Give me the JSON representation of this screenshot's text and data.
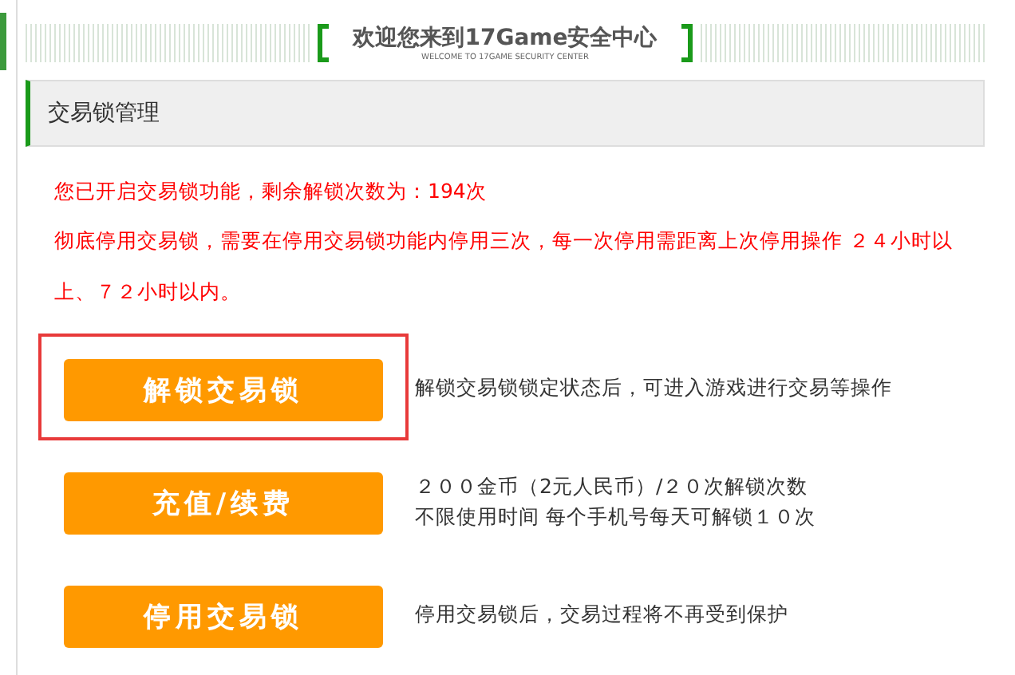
{
  "header": {
    "title": "欢迎您来到17Game安全中心",
    "subtitle": "WELCOME TO 17GAME SECURITY CENTER"
  },
  "panel": {
    "title": "交易锁管理"
  },
  "notices": [
    "您已开启交易锁功能，剩余解锁次数为：194次",
    "彻底停用交易锁，需要在停用交易锁功能内停用三次，每一次停用需距离上次停用操作 ２４小时以上、７２小时以内。"
  ],
  "actions": [
    {
      "label": "解锁交易锁",
      "highlighted": true,
      "description": [
        "解锁交易锁锁定状态后，可进入游戏进行交易等操作"
      ]
    },
    {
      "label": "充值/续费",
      "highlighted": false,
      "description": [
        "２００金币（2元人民币）/２０次解锁次数",
        "不限使用时间 每个手机号每天可解锁１０次"
      ]
    },
    {
      "label": "停用交易锁",
      "highlighted": false,
      "description": [
        "停用交易锁后，交易过程将不再受到保护"
      ]
    }
  ]
}
